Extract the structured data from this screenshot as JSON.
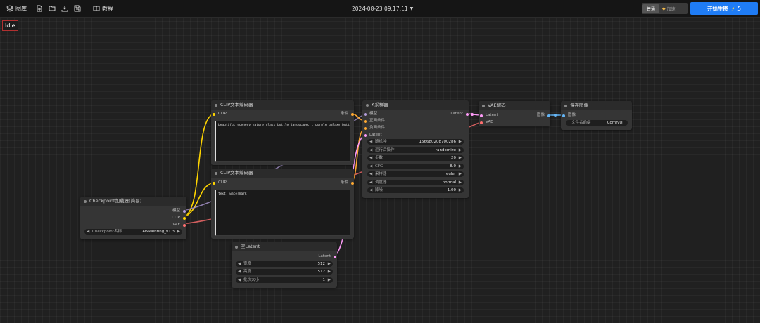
{
  "topbar": {
    "library_label": "图库",
    "tutorial_label": "教程",
    "datetime": "2024-08-23 09:17:11",
    "mode_normal": "普通",
    "mode_fast": "加速",
    "generate_label": "开始生图",
    "generate_cost": "5"
  },
  "status": "Idle",
  "nodes": {
    "checkpoint": {
      "title": "Checkpoint加载器(简易)",
      "out_model": "模型",
      "out_clip": "CLIP",
      "out_vae": "VAE",
      "ckpt_label": "Checkpoint名称",
      "ckpt_value": "AWPainting_v1.3"
    },
    "clip_pos": {
      "title": "CLIP文本编码器",
      "in_clip": "CLIP",
      "out_cond": "条件",
      "text": "beautiful scenery nature glass bottle landscape, , purple galaxy bottle,"
    },
    "clip_neg": {
      "title": "CLIP文本编码器",
      "in_clip": "CLIP",
      "out_cond": "条件",
      "text": "text, watermark"
    },
    "ksampler": {
      "title": "K采样器",
      "in_model": "模型",
      "in_pos": "正面条件",
      "in_neg": "负面条件",
      "in_latent": "Latent",
      "out_latent": "Latent",
      "widgets": [
        {
          "label": "随机种",
          "value": "156680208700286"
        },
        {
          "label": "运行后操作",
          "value": "randomize"
        },
        {
          "label": "步数",
          "value": "20"
        },
        {
          "label": "CFG",
          "value": "8.0"
        },
        {
          "label": "采样器",
          "value": "euler"
        },
        {
          "label": "调度器",
          "value": "normal"
        },
        {
          "label": "降噪",
          "value": "1.00"
        }
      ]
    },
    "vae": {
      "title": "VAE解码",
      "in_latent": "Latent",
      "in_vae": "VAE",
      "out_image": "图像"
    },
    "save": {
      "title": "保存图像",
      "in_image": "图像",
      "prefix_label": "文件名前缀",
      "prefix_value": "ComfyUI"
    },
    "latent": {
      "title": "空Latent",
      "out_latent": "Latent",
      "widgets": [
        {
          "label": "宽度",
          "value": "512"
        },
        {
          "label": "高度",
          "value": "512"
        },
        {
          "label": "批次大小",
          "value": "1"
        }
      ]
    }
  },
  "colors": {
    "model": "#b39ddb",
    "clip": "#ffd500",
    "vae": "#ff6e6e",
    "conditioning": "#ffa931",
    "latent": "#ff9cf9",
    "image": "#64b5f6",
    "accent": "#1f7cf5"
  }
}
